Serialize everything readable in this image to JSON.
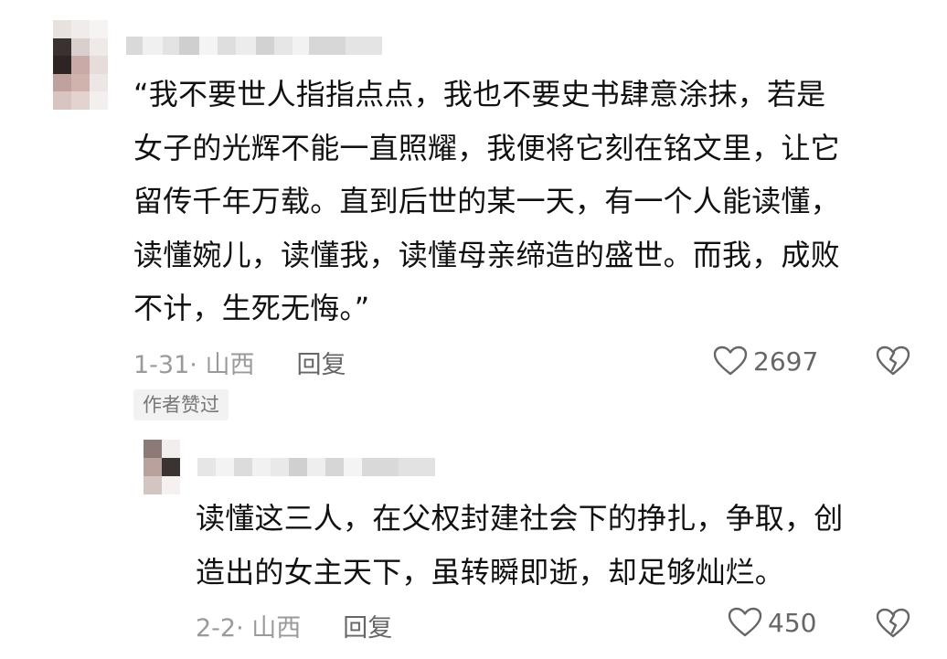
{
  "comment": {
    "text_lines": [
      "“我不要世人指指点点，我也不要史书肆意涂抹，若是",
      "女子的光辉不能一直照耀，我便将它刻在铭文里，让它",
      "留传千年万载。直到后世的某一天，有一个人能读懂，",
      "读懂婉儿，读懂我，读懂母亲缔造的盛世。而我，成败",
      "不计，生死无悔。”"
    ],
    "date_location": "1-31· 山西",
    "reply_label": "回复",
    "like_count": "2697",
    "author_liked_badge": "作者赞过"
  },
  "reply": {
    "text_lines": [
      "读懂这三人，在父权封建社会下的挣扎，争取，创",
      "造出的女主天下，虽转瞬即逝，却足够灿烂。"
    ],
    "date_location": "2-2· 山西",
    "reply_label": "回复",
    "like_count": "450"
  },
  "colors": {
    "text": "#111111",
    "meta": "#9a9a9a",
    "badge_bg": "#f2f2f2"
  },
  "icons": {
    "like": "heart-outline-icon",
    "dislike": "broken-heart-icon"
  }
}
